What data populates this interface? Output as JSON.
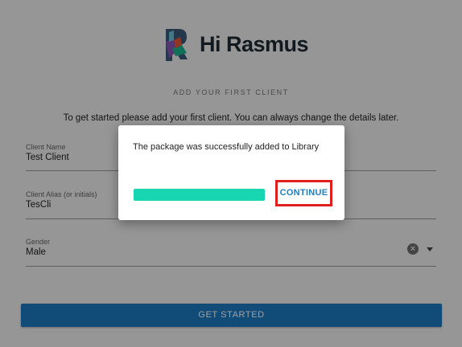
{
  "app": {
    "logo_text": "Hi Rasmus"
  },
  "form": {
    "section_title": "ADD YOUR FIRST CLIENT",
    "intro": "To get started please add your first client. You can always change the details later.",
    "client_name": {
      "label": "Client Name",
      "value": "Test Client"
    },
    "client_alias": {
      "label": "Client Alias (or initials)",
      "value": "TesCli"
    },
    "gender": {
      "label": "Gender",
      "value": "Male"
    },
    "submit_label": "GET STARTED"
  },
  "dialog": {
    "message": "The package was successfully added to Library",
    "progress_percent": 100,
    "continue_label": "CONTINUE"
  },
  "colors": {
    "primary": "#1c7bc4",
    "progress": "#19d6b3",
    "highlight": "#e0201e"
  },
  "icons": {
    "clear": "clear-circle-icon",
    "dropdown": "caret-down-icon"
  }
}
